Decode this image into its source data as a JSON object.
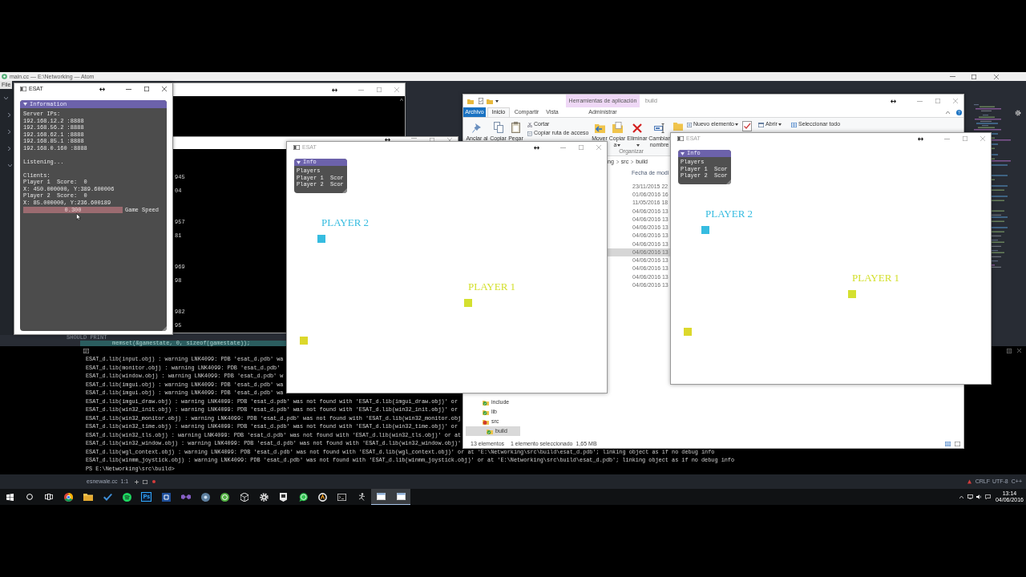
{
  "atom": {
    "title": "main.cc — E:\\Networking — Atom",
    "menu": [
      "File"
    ],
    "tree": [
      {
        "expanded": true,
        "children": [
          {
            "expanded": false
          },
          {
            "expanded": false
          },
          {
            "expanded": false
          },
          {
            "expanded": true
          }
        ]
      }
    ],
    "editor_lines": [
      {
        "text": "SHOULD PRINT",
        "highlighted": false
      },
      {
        "text": "memset(&gamestate, 0, sizeof(gamestate));",
        "highlighted": true
      }
    ],
    "terminal": {
      "lines": [
        "ESAT_d.lib(input.obj) : warning LNK4099: PDB 'esat_d.pdb' wa",
        "ESAT_d.lib(monitor.obj) : warning LNK4099: PDB 'esat_d.pdb'",
        "ESAT_d.lib(window.obj) : warning LNK4099: PDB 'esat_d.pdb' w",
        "ESAT_d.lib(imgui.obj) : warning LNK4099: PDB 'esat_d.pdb' wa",
        "ESAT_d.lib(imgui.obj) : warning LNK4099: PDB 'esat_d.pdb' wa",
        "ESAT_d.lib(imgui_draw.obj) : warning LNK4099: PDB 'esat_d.pdb' was not found with 'ESAT_d.lib(imgui_draw.obj)' or",
        "ESAT_d.lib(win32_init.obj) : warning LNK4099: PDB 'esat_d.pdb' was not found with 'ESAT_d.lib(win32_init.obj)' or",
        "ESAT_d.lib(win32_monitor.obj) : warning LNK4099: PDB 'esat_d.pdb' was not found with 'ESAT_d.lib(win32_monitor.obj",
        "ESAT_d.lib(win32_time.obj) : warning LNK4099: PDB 'esat_d.pdb' was not found with 'ESAT_d.lib(win32_time.obj)' or",
        "ESAT_d.lib(win32_tls.obj) : warning LNK4099: PDB 'esat_d.pdb' was not found with 'ESAT_d.lib(win32_tls.obj)' or at",
        "ESAT_d.lib(win32_window.obj) : warning LNK4099: PDB 'esat_d.pdb' was not found with 'ESAT_d.lib(win32_window.obj)'",
        "ESAT_d.lib(wgl_context.obj) : warning LNK4099: PDB 'esat_d.pdb' was not found with 'ESAT_d.lib(wgl_context.obj)' or at 'E:\\Networking\\src\\build\\esat_d.pdb'; linking object as if no debug info",
        "ESAT_d.lib(winmm_joystick.obj) : warning LNK4099: PDB 'esat_d.pdb' was not found with 'ESAT_d.lib(winmm_joystick.obj)' or at 'E:\\Networking\\src\\build\\esat_d.pdb'; linking object as if no debug info"
      ],
      "prompt": "PS E:\\Networking\\src\\build>"
    },
    "status_bar": {
      "file": "esnewale.cc",
      "cursor": "1:1",
      "line_ending": "CRLF",
      "encoding": "UTF-8",
      "grammar": "C++"
    }
  },
  "console_windows": [
    {
      "scroll_arrow": true
    },
    {
      "lines": [
        "945",
        "04",
        "957",
        "81",
        "969",
        "98",
        "982",
        "95"
      ]
    }
  ],
  "server_window": {
    "title": "ESAT",
    "active": true,
    "panel": {
      "title": "Information",
      "expanded": true,
      "sections": [
        [
          "Server IPs:",
          "192.168.12.2 :8888",
          "192.168.56.2 :8888",
          "192.168.62.1 :8888",
          "192.168.85.1 :8888",
          "192.168.0.160 :8888"
        ],
        [
          "Listening..."
        ],
        [
          "Clients:",
          "Player 1  Score:  0",
          "X: 450.000000, Y:389.600006",
          "Player 2  Score:  0",
          "X: 85.000000, Y:236.600189"
        ]
      ],
      "slider": {
        "value": "0.300",
        "label": "Game Speed"
      }
    }
  },
  "explorer": {
    "title": "build",
    "context_tab": "Herramientas de aplicación",
    "file_tab": "Archivo",
    "tabs": [
      {
        "label": "Inicio",
        "selected": true
      },
      {
        "label": "Compartir",
        "selected": false
      },
      {
        "label": "Vista",
        "selected": false
      },
      {
        "label": "Administrar",
        "selected": false
      }
    ],
    "ribbon": [
      {
        "commands": [
          {
            "label": "Anclar al",
            "kind": "large",
            "dropdown": false
          },
          {
            "label": "Copiar",
            "kind": "large",
            "dropdown": false
          },
          {
            "label": "Pegar",
            "kind": "large",
            "dropdown": false
          },
          {
            "label": "Cortar",
            "kind": "small",
            "dropdown": false
          },
          {
            "label": "Copiar ruta de acceso",
            "kind": "small",
            "dropdown": false
          }
        ]
      },
      {
        "label": "Organizar",
        "commands": [
          {
            "label": "Mover",
            "kind": "large",
            "dropdown": false
          },
          {
            "label": "Copiar a",
            "kind": "large",
            "dropdown": true
          },
          {
            "label": "Eliminar",
            "kind": "large",
            "dropdown": true
          },
          {
            "label": "Cambiar nombre",
            "kind": "large",
            "dropdown": false
          }
        ]
      },
      {
        "commands": [
          {
            "label": "Nuevo elemento",
            "kind": "small",
            "dropdown": true
          }
        ]
      },
      {
        "commands": [
          {
            "label": "Abrir",
            "kind": "small",
            "dropdown": true
          }
        ]
      },
      {
        "commands": [
          {
            "label": "Seleccionar todo",
            "kind": "small",
            "dropdown": false
          }
        ]
      }
    ],
    "breadcrumb": [
      "ng",
      "src",
      "build"
    ],
    "column_header": "Fecha de modi",
    "rows": [
      {
        "date": "23/11/2015 22",
        "selected": false
      },
      {
        "date": "01/06/2016 16",
        "selected": false
      },
      {
        "date": "11/05/2016 18",
        "selected": false
      },
      {
        "date": "04/06/2016 13",
        "selected": false
      },
      {
        "date": "04/06/2016 13",
        "selected": false
      },
      {
        "date": "04/06/2016 13",
        "selected": false
      },
      {
        "date": "04/06/2016 13",
        "selected": false
      },
      {
        "date": "04/06/2016 13",
        "selected": false
      },
      {
        "date": "04/06/2016 13",
        "selected": true
      },
      {
        "date": "04/06/2016 13",
        "selected": false
      },
      {
        "date": "04/06/2016 13",
        "selected": false
      },
      {
        "date": "04/06/2016 13",
        "selected": false
      },
      {
        "date": "04/06/2016 13",
        "selected": false
      }
    ],
    "nav": [
      {
        "label": "include",
        "selected": false,
        "sync_error": false
      },
      {
        "label": "lib",
        "selected": false,
        "sync_error": false
      },
      {
        "label": "src",
        "selected": false,
        "sync_error": true,
        "children": [
          {
            "label": "build",
            "selected": true,
            "sync_error": false
          }
        ]
      }
    ],
    "status": {
      "count": "13 elementos",
      "selection": "1 elemento seleccionado",
      "size": "1,65 MB"
    }
  },
  "game_windows": [
    {
      "title": "ESAT",
      "active": false,
      "panel": {
        "title": "Info",
        "expanded": true,
        "lines": [
          "Players",
          "Player 1  Scor",
          "Player 2  Scor"
        ]
      },
      "players": [
        {
          "name": "PLAYER 2",
          "color": "#36bce0"
        },
        {
          "name": "PLAYER 1",
          "color": "#d4e030"
        }
      ],
      "markers": [
        {
          "color": "#dcd82c"
        }
      ]
    },
    {
      "title": "ESAT",
      "active": false,
      "panel": {
        "title": "Info",
        "expanded": true,
        "lines": [
          "Players",
          "Player 1  Scor",
          "Player 2  Scor"
        ]
      },
      "players": [
        {
          "name": "PLAYER 2",
          "color": "#36bce0"
        },
        {
          "name": "PLAYER 1",
          "color": "#d4e030"
        }
      ],
      "markers": [
        {
          "color": "#dcd82c"
        }
      ]
    }
  ],
  "taskbar": {
    "buttons": [
      {
        "kind": "start",
        "open": false
      },
      {
        "kind": "search",
        "open": false
      },
      {
        "kind": "task_view",
        "open": false
      },
      {
        "kind": "browser",
        "open": false
      },
      {
        "kind": "folder",
        "open": false
      },
      {
        "kind": "check",
        "open": false
      },
      {
        "kind": "waves",
        "open": false
      },
      {
        "kind": "letters",
        "label": "Ps",
        "open": false
      },
      {
        "kind": "tile",
        "open": false
      },
      {
        "kind": "infinity",
        "open": false
      },
      {
        "kind": "disc",
        "open": false
      },
      {
        "kind": "sphere",
        "open": false
      },
      {
        "kind": "cube",
        "open": false
      },
      {
        "kind": "gear",
        "open": false
      },
      {
        "kind": "badge",
        "open": false
      },
      {
        "kind": "chat",
        "open": false
      },
      {
        "kind": "ring",
        "open": false
      },
      {
        "kind": "terminal",
        "open": false
      },
      {
        "kind": "figure",
        "open": false
      },
      {
        "kind": "window",
        "open": true
      },
      {
        "kind": "window",
        "open": true
      }
    ],
    "time": "13:14",
    "date": "04/06/2016"
  }
}
